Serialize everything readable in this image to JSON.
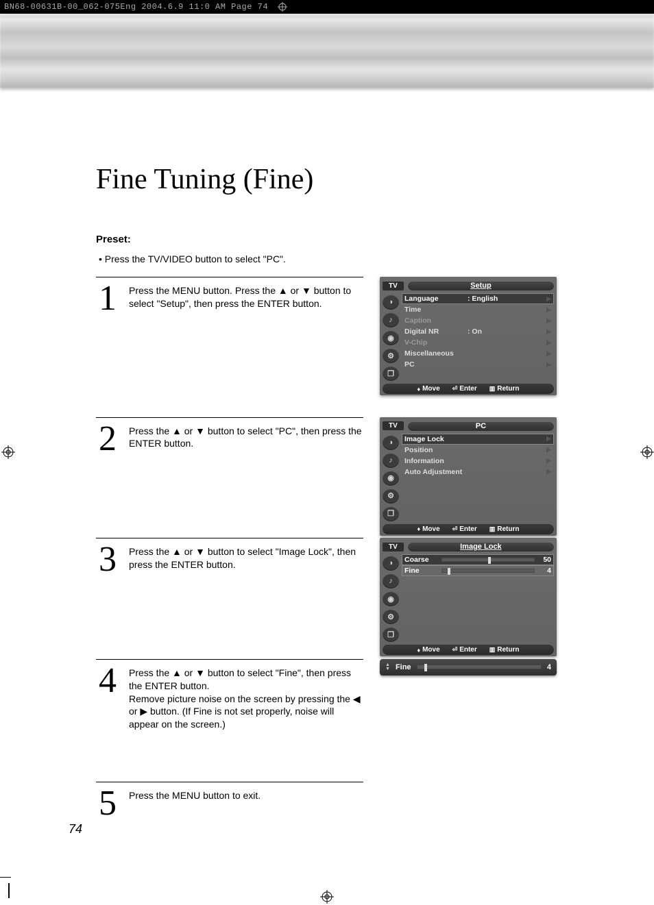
{
  "print_header": "BN68-00631B-00_062-075Eng  2004.6.9  11:0 AM  Page 74",
  "title_main": "Fine Tuning",
  "title_paren": "(Fine)",
  "preset_label": "Preset:",
  "preset_bullet": "•   Press the TV/VIDEO button to select \"PC\".",
  "steps": {
    "s1": {
      "num": "1",
      "text": "Press the MENU button. Press the ▲ or ▼ button to select \"Setup\", then press the ENTER button."
    },
    "s2": {
      "num": "2",
      "text": "Press the ▲ or ▼ button to select \"PC\", then press the ENTER button."
    },
    "s3": {
      "num": "3",
      "text": "Press the ▲ or ▼ button to select \"Image Lock\", then press the ENTER button."
    },
    "s4": {
      "num": "4",
      "text": "Press the ▲ or ▼ button to select \"Fine\", then press the ENTER button.\nRemove picture noise on the screen by pressing the ◀ or ▶ button. (If Fine is not set properly, noise will appear on the screen.)"
    },
    "s5": {
      "num": "5",
      "text": "Press the MENU button to exit."
    }
  },
  "osd_common": {
    "tv": "TV",
    "move": "Move",
    "enter": "Enter",
    "return": "Return"
  },
  "osd_setup": {
    "title": "Setup",
    "rows": [
      {
        "label": "Language",
        "value": ":  English",
        "sel": true
      },
      {
        "label": "Time",
        "value": ""
      },
      {
        "label": "Caption",
        "value": "",
        "dim": true
      },
      {
        "label": "Digital NR",
        "value": ":  On"
      },
      {
        "label": "V-Chip",
        "value": "",
        "dim": true
      },
      {
        "label": "Miscellaneous",
        "value": ""
      },
      {
        "label": "PC",
        "value": ""
      }
    ]
  },
  "osd_pc": {
    "title": "PC",
    "rows": [
      {
        "label": "Image Lock",
        "sel": true
      },
      {
        "label": "Position"
      },
      {
        "label": "Information"
      },
      {
        "label": "Auto Adjustment"
      }
    ]
  },
  "osd_imagelock": {
    "title": "Image Lock",
    "coarse_label": "Coarse",
    "coarse_value": "50",
    "fine_label": "Fine",
    "fine_value": "4"
  },
  "fine_bar": {
    "label": "Fine",
    "value": "4"
  },
  "page_number": "74"
}
